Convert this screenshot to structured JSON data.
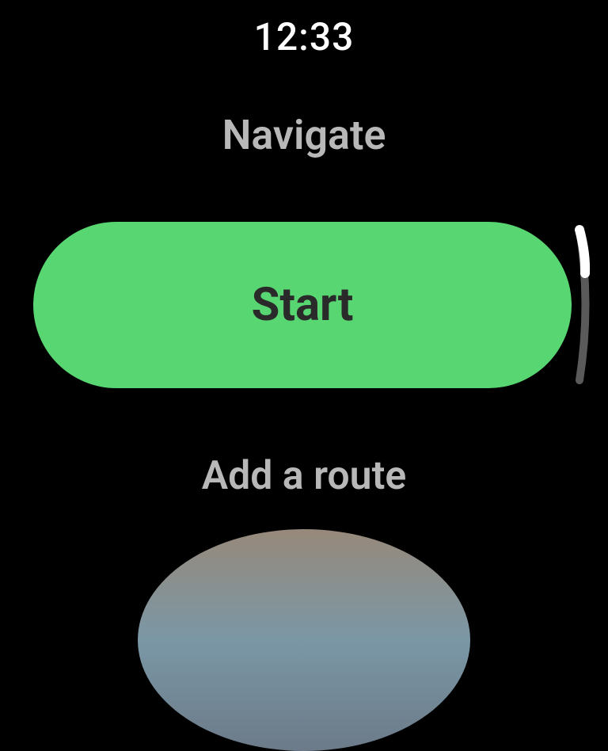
{
  "status": {
    "time": "12:33"
  },
  "title": "Navigate",
  "start_button": {
    "label": "Start"
  },
  "add_route": {
    "label": "Add a route"
  },
  "colors": {
    "accent": "#58d671",
    "text_muted": "#b8b8b8",
    "text_dark": "#2a2a2a"
  }
}
